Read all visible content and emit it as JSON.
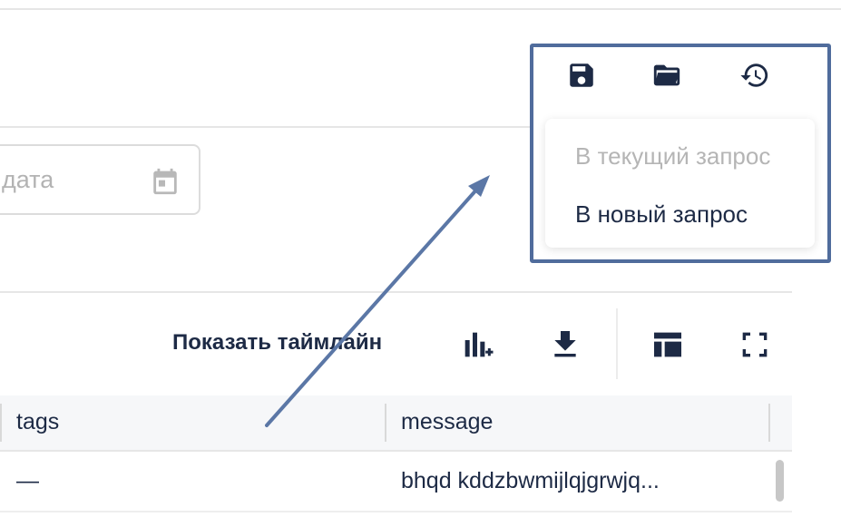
{
  "filters": {
    "date_placeholder": "дата",
    "calendar_icon": "calendar-icon"
  },
  "toolbar": {
    "show_timeline_label": "Показать таймлайн",
    "icons": [
      "add-chart-icon",
      "download-icon",
      "table-layout-icon",
      "fullscreen-icon"
    ]
  },
  "query_actions": {
    "icons": [
      "save-icon",
      "folder-open-icon",
      "history-icon"
    ],
    "menu": {
      "items": [
        {
          "label": "В текущий запрос",
          "disabled": true
        },
        {
          "label": "В новый запрос",
          "disabled": false
        }
      ]
    }
  },
  "table": {
    "columns": [
      "tags",
      "message"
    ],
    "rows": [
      {
        "tags": "—",
        "message": "bhqd kddzbwmijlqjgrwjq..."
      }
    ]
  },
  "colors": {
    "text": "#1d2a45",
    "highlight_border": "#506c9c",
    "arrow": "#5b77a6",
    "placeholder": "#b3b3b3"
  }
}
